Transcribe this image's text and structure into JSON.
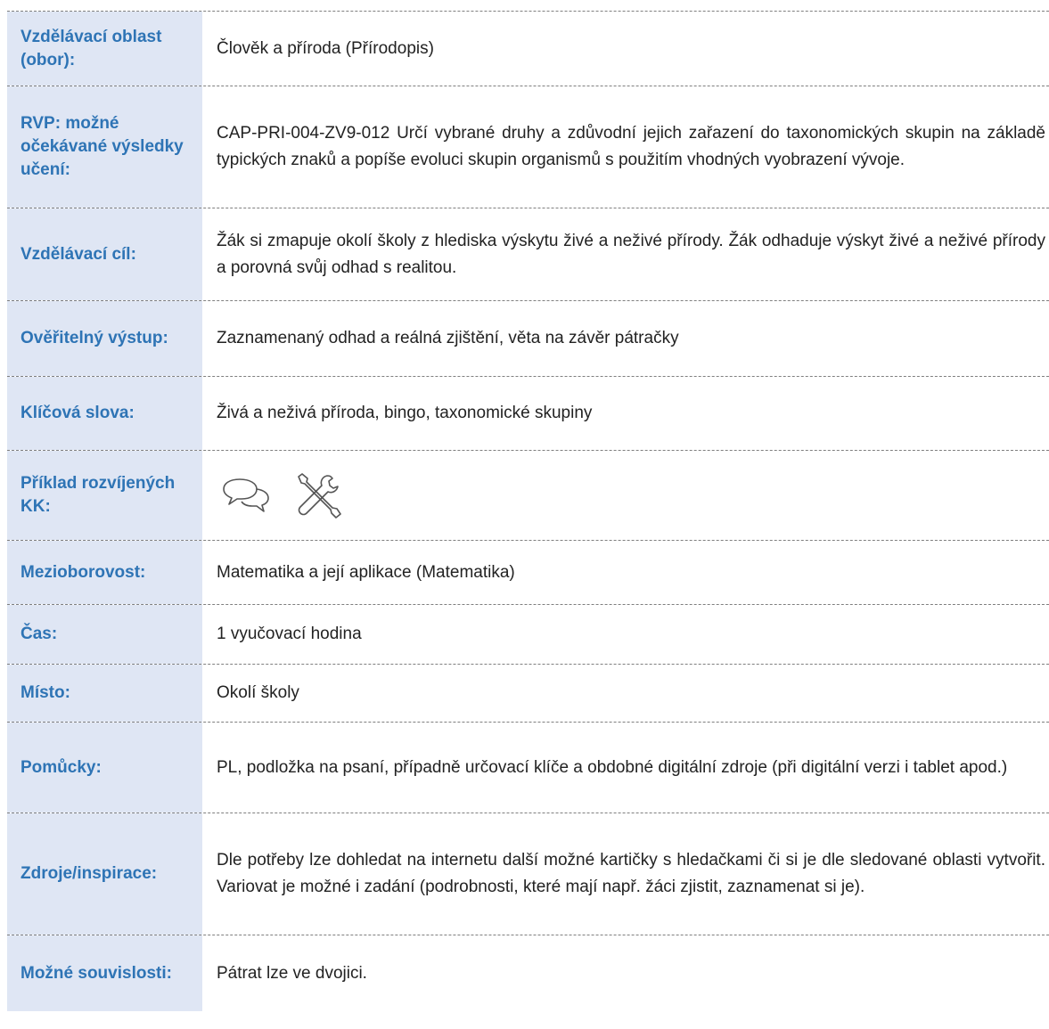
{
  "rows": [
    {
      "label": "Vzdělávací oblast (obor):",
      "value": "Člověk a příroda (Přírodopis)"
    },
    {
      "label": "RVP: možné očekávané výsledky učení:",
      "value": "CAP-PRI-004-ZV9-012 Určí vybrané druhy a zdůvodní jejich zařazení do taxonomických skupin na základě typických znaků a popíše evoluci skupin organismů s použitím vhodných vyobrazení vývoje."
    },
    {
      "label": "Vzdělávací cíl:",
      "value": "Žák si zmapuje okolí školy z hlediska výskytu živé a neživé přírody. Žák odhaduje výskyt živé a neživé přírody a porovná svůj odhad s realitou."
    },
    {
      "label": "Ověřitelný výstup:",
      "value": "Zaznamenaný odhad a reálná zjištění, věta na závěr pátračky"
    },
    {
      "label": "Klíčová slova:",
      "value": "Živá a neživá příroda, bingo, taxonomické skupiny"
    },
    {
      "label": "Příklad rozvíjených KK:",
      "icons": [
        "speech-bubbles-icon",
        "tools-icon"
      ]
    },
    {
      "label": "Mezioborovost:",
      "value": "Matematika a její aplikace (Matematika)"
    },
    {
      "label": "Čas:",
      "value": "1 vyučovací hodina"
    },
    {
      "label": "Místo:",
      "value": "Okolí školy"
    },
    {
      "label": "Pomůcky:",
      "value": "PL, podložka na psaní, případně určovací klíče a obdobné digitální zdroje (při digitální verzi i tablet apod.)"
    },
    {
      "label": "Zdroje/inspirace:",
      "value": "Dle potřeby lze dohledat na internetu další možné kartičky s hledačkami či si je dle sledované oblasti vytvořit. Variovat je možné i zadání (podrobnosti, které mají např. žáci zjistit, zaznamenat si je)."
    },
    {
      "label": "Možné souvislosti:",
      "value": "Pátrat lze ve dvojici."
    }
  ],
  "colors": {
    "label_bg": "#dfe6f4",
    "label_text": "#2e74b5",
    "border": "#7f7f7f"
  }
}
